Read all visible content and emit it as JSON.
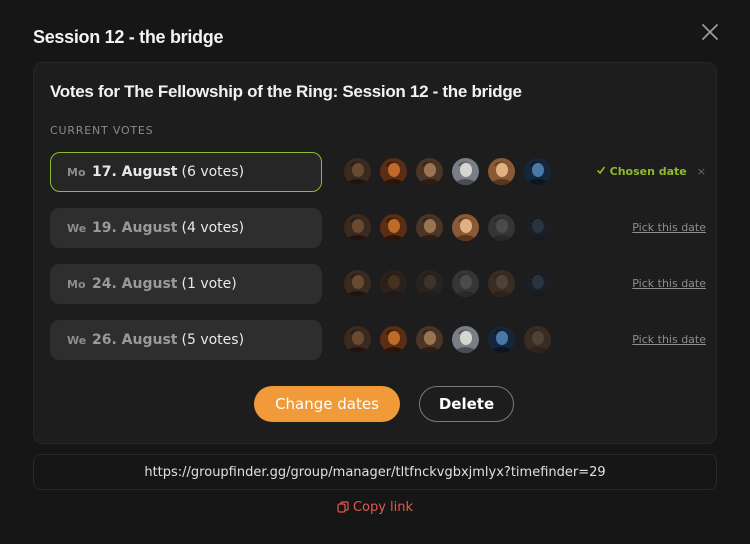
{
  "modal": {
    "title": "Session 12 - the bridge"
  },
  "card": {
    "title": "Votes for The Fellowship of the Ring: Session 12 - the bridge",
    "section_label": "CURRENT VOTES"
  },
  "colors": {
    "accent_orange": "#f09a3a",
    "chosen_green": "#8dbb2c",
    "copy_red": "#e55a4a"
  },
  "votes": [
    {
      "dow": "Mo",
      "date": "17. August",
      "count": "(6 votes)",
      "chosen": true,
      "status_label": "Chosen date",
      "status_dismiss": "×",
      "avatars": [
        {
          "name": "avatar-1",
          "dim": false
        },
        {
          "name": "avatar-2",
          "dim": false
        },
        {
          "name": "avatar-3",
          "dim": false
        },
        {
          "name": "avatar-4",
          "dim": false
        },
        {
          "name": "avatar-5",
          "dim": false
        },
        {
          "name": "avatar-6",
          "dim": false
        }
      ]
    },
    {
      "dow": "We",
      "date": "19. August",
      "count": "(4 votes)",
      "chosen": false,
      "status_label": "Pick this date",
      "avatars": [
        {
          "name": "avatar-1",
          "dim": false
        },
        {
          "name": "avatar-2",
          "dim": false
        },
        {
          "name": "avatar-3",
          "dim": false
        },
        {
          "name": "avatar-5",
          "dim": false
        },
        {
          "name": "avatar-4",
          "dim": true
        },
        {
          "name": "avatar-6",
          "dim": true
        }
      ]
    },
    {
      "dow": "Mo",
      "date": "24. August",
      "count": "(1 vote)",
      "chosen": false,
      "status_label": "Pick this date",
      "avatars": [
        {
          "name": "avatar-1",
          "dim": false
        },
        {
          "name": "avatar-2",
          "dim": true
        },
        {
          "name": "avatar-3",
          "dim": true
        },
        {
          "name": "avatar-4",
          "dim": true
        },
        {
          "name": "avatar-5",
          "dim": true
        },
        {
          "name": "avatar-6",
          "dim": true
        }
      ]
    },
    {
      "dow": "We",
      "date": "26. August",
      "count": "(5 votes)",
      "chosen": false,
      "status_label": "Pick this date",
      "avatars": [
        {
          "name": "avatar-1",
          "dim": false
        },
        {
          "name": "avatar-2",
          "dim": false
        },
        {
          "name": "avatar-3",
          "dim": false
        },
        {
          "name": "avatar-4",
          "dim": false
        },
        {
          "name": "avatar-6",
          "dim": false
        },
        {
          "name": "avatar-5",
          "dim": true
        }
      ]
    }
  ],
  "actions": {
    "change_dates": "Change dates",
    "delete": "Delete"
  },
  "share": {
    "url": "https://groupfinder.gg/group/manager/tltfnckvgbxjmlyx?timefinder=29",
    "copy_label": "Copy link"
  }
}
